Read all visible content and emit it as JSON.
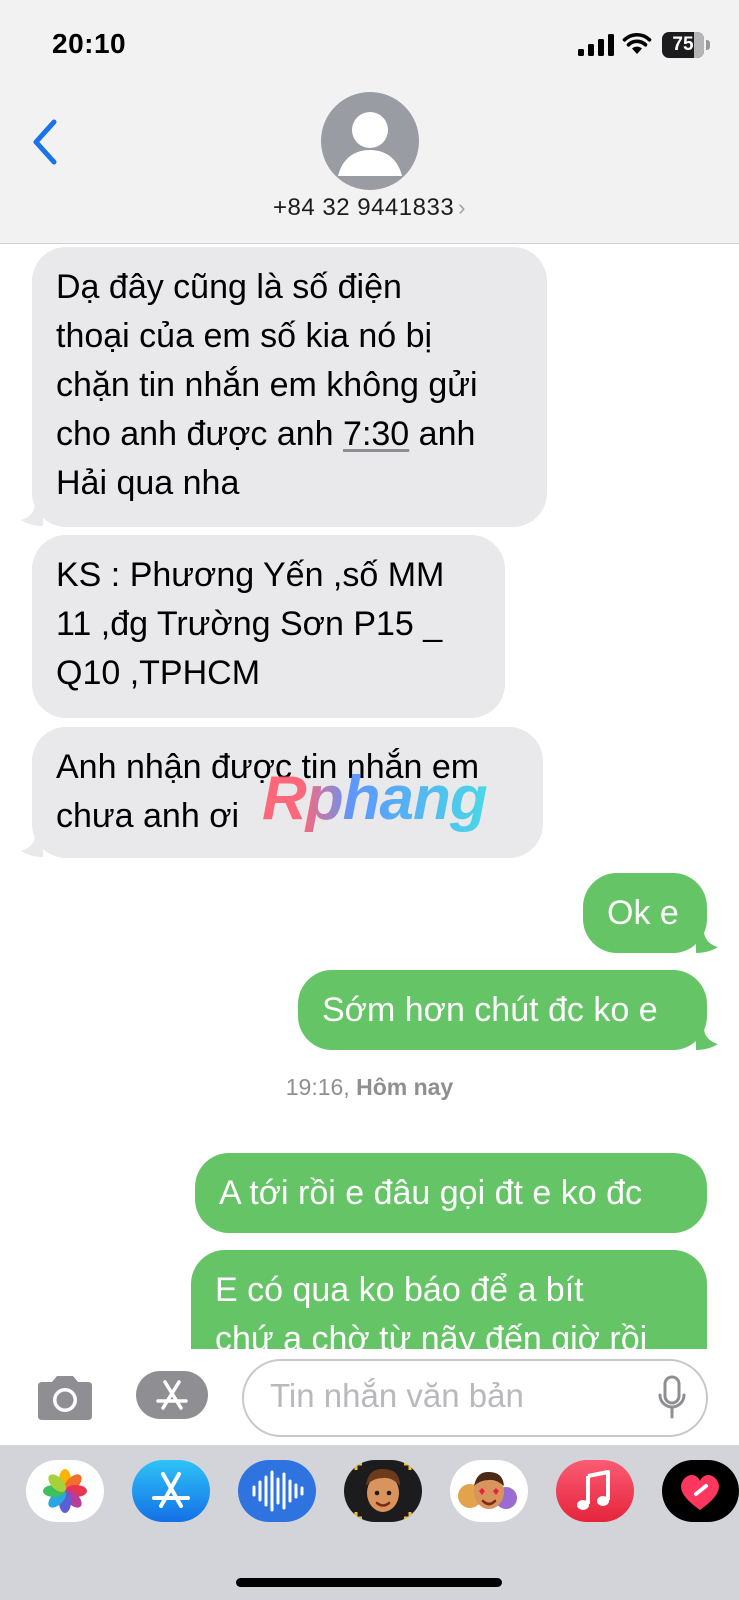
{
  "status_bar": {
    "time": "20:10",
    "battery": "75",
    "battery_level": 0.75,
    "signal_icon": "cellular-signal-icon",
    "wifi_icon": "wifi-icon"
  },
  "header": {
    "contact": "+84 32 9441833",
    "chevron": "›",
    "back_icon": "chevron-left-icon",
    "avatar_icon": "person-silhouette-icon"
  },
  "messages": [
    {
      "direction": "incoming",
      "lines": [
        "Dạ đây cũng là số điện",
        "thoại của em số kia nó bị",
        "chặn tin nhắn em không gửi",
        "cho anh được anh ",
        "Hải qua nha"
      ],
      "inline_time": "7:30",
      "inline_after": " anh"
    },
    {
      "direction": "incoming",
      "lines": [
        "KS : Phương Yến  ,số MM",
        "11 ,đg Trường Sơn   P15 _",
        "Q10  ,TPHCM"
      ]
    },
    {
      "direction": "incoming",
      "lines": [
        "Anh nhận được tin nhắn em",
        "chưa anh ơi"
      ]
    },
    {
      "direction": "outgoing",
      "lines": [
        "Ok e"
      ]
    },
    {
      "direction": "outgoing",
      "lines": [
        "Sớm hơn chút đc ko e"
      ]
    },
    {
      "direction": "outgoing",
      "lines": [
        "A tới rồi e đâu gọi đt e ko đc"
      ]
    },
    {
      "direction": "outgoing",
      "lines": [
        "E có qua ko báo để a bít",
        "chứ a chờ từ nãy đến giờ rồi"
      ]
    }
  ],
  "timestamp": {
    "time": "19:16,",
    "day": "Hôm nay"
  },
  "watermark": "Rphang",
  "input_bar": {
    "placeholder": "Tin nhắn văn bản",
    "camera_icon": "camera-icon",
    "apps_icon": "app-store-icon",
    "mic_icon": "microphone-icon"
  },
  "app_drawer": {
    "apps": [
      "photos-icon",
      "app-store-icon",
      "audio-message-icon",
      "memoji-icon",
      "animoji-stickers-icon",
      "music-icon",
      "digital-touch-icon"
    ]
  },
  "colors": {
    "outgoing_bubble": "#65c466",
    "incoming_bubble": "#e9e9eb",
    "accent_blue": "#1a73e8",
    "header_bg": "#f2f2f3",
    "drawer_bg": "#d3d4d9"
  }
}
